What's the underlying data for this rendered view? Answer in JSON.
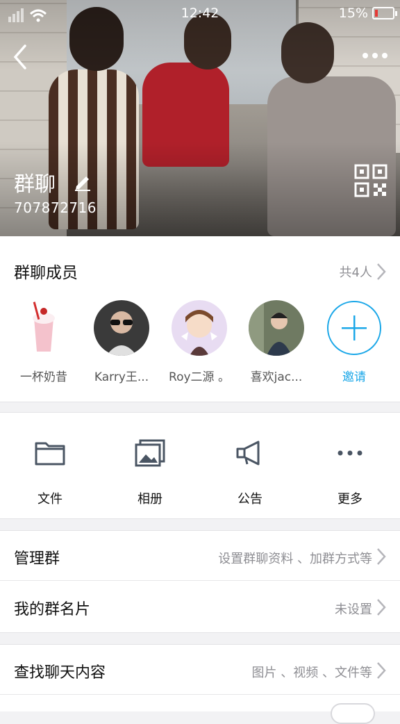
{
  "status_bar": {
    "time": "12:42",
    "battery": "15%",
    "battery_level": 0.15
  },
  "header": {
    "group_name": "群聊",
    "group_id": "707872716"
  },
  "members": {
    "title": "群聊成员",
    "count": "共4人",
    "list": [
      {
        "name": "一杯奶昔"
      },
      {
        "name": "Karry王..."
      },
      {
        "name": "Roy二源 。"
      },
      {
        "name": "喜欢jac..."
      }
    ],
    "invite_label": "邀请"
  },
  "tools": [
    {
      "label": "文件",
      "icon": "folder-icon"
    },
    {
      "label": "相册",
      "icon": "album-icon"
    },
    {
      "label": "公告",
      "icon": "megaphone-icon"
    },
    {
      "label": "更多",
      "icon": "more-icon"
    }
  ],
  "settings": {
    "manage": {
      "label": "管理群",
      "value": "设置群聊资料 、加群方式等"
    },
    "card": {
      "label": "我的群名片",
      "value": "未设置"
    },
    "search": {
      "label": "查找聊天内容",
      "value": "图片 、视频 、文件等"
    }
  },
  "colors": {
    "accent": "#1aa7e8",
    "battery_low": "#e53935"
  }
}
